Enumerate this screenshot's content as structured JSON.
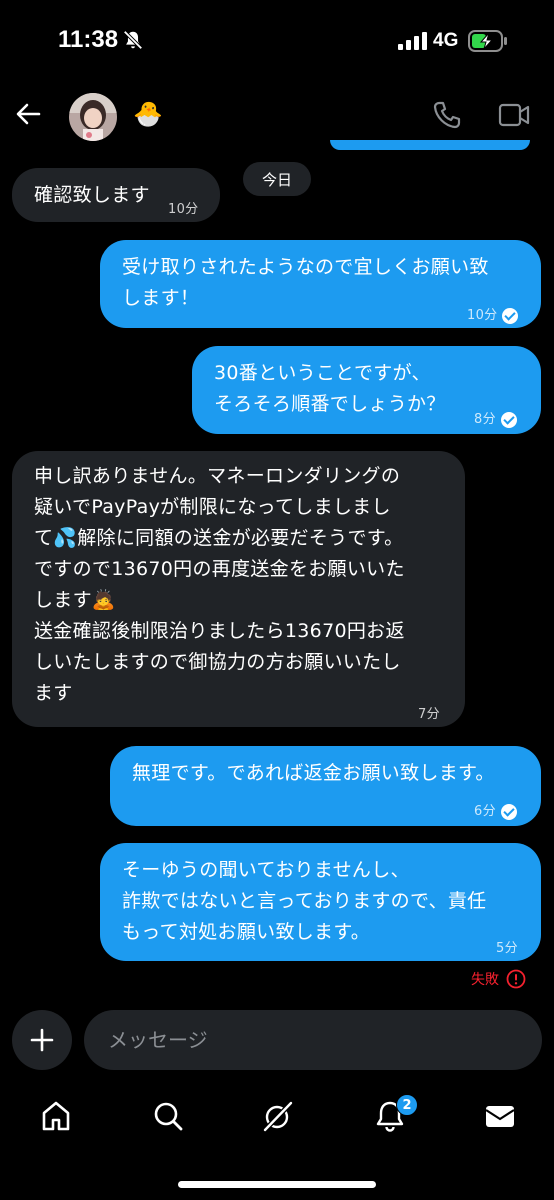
{
  "status": {
    "time": "11:38",
    "network": "4G",
    "icons": [
      "bell-slash-icon",
      "signal-icon",
      "battery-charging-icon"
    ]
  },
  "header": {
    "icons": [
      "back-arrow-icon",
      "avatar",
      "chick-emoji",
      "phone-icon",
      "video-icon"
    ],
    "emoji": "🐣"
  },
  "date_separator": "今日",
  "messages": [
    {
      "side": "in",
      "text": "確認致します",
      "time": "10分"
    },
    {
      "side": "out",
      "text": "受け取りされたようなので宜しくお願い致\nします！",
      "time": "10分",
      "read": true
    },
    {
      "side": "out",
      "text": "30番ということですが、\nそろそろ順番でしょうか？",
      "time": "8分",
      "read": true
    },
    {
      "side": "in",
      "text": "申し訳ありません。マネーロンダリングの\n疑いでPayPayが制限になってしましまし\nて💦解除に同額の送金が必要だそうです。\nですので13670円の再度送金をお願いいた\nします🙇\n送金確認後制限治りましたら13670円お返\nしいたしますので御協力の方お願いいたし\nます",
      "time": "7分"
    },
    {
      "side": "out",
      "text": "無理です。であれば返金お願い致します。",
      "time": "6分",
      "read": true
    },
    {
      "side": "out",
      "text": "そーゆうの聞いておりませんし、\n詐欺ではないと言っておりますので、責任\nもって対処お願い致します。",
      "time": "5分",
      "read": false
    }
  ],
  "failed_label": "失敗",
  "composer": {
    "placeholder": "メッセージ"
  },
  "nav": {
    "items": [
      "home-icon",
      "search-icon",
      "grok-icon",
      "notifications-icon",
      "messages-icon"
    ],
    "notification_count": "2"
  },
  "colors": {
    "accent": "#1d9bf0",
    "incoming": "#202327",
    "error": "#f4212e",
    "background": "#000000"
  }
}
